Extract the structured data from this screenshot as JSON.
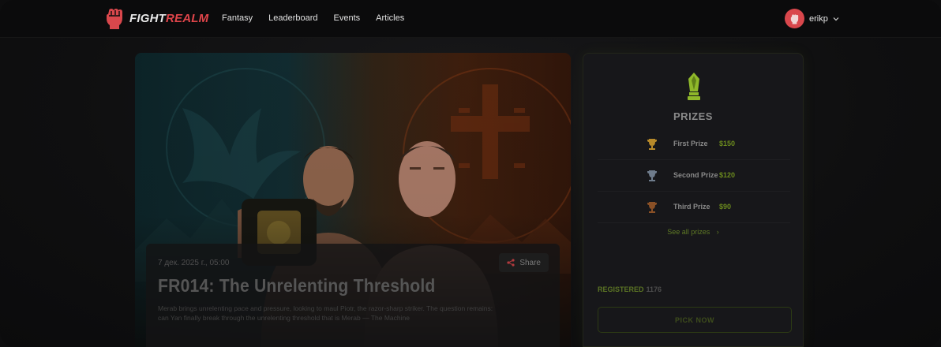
{
  "brand": {
    "logo_part1": "FIGHT",
    "logo_part2": "REALM"
  },
  "nav": {
    "links": [
      "Fantasy",
      "Leaderboard",
      "Events",
      "Articles"
    ]
  },
  "user": {
    "name": "erikp"
  },
  "event": {
    "date": "7 дек. 2025 г., 05:00",
    "share_label": "Share",
    "title": "FR014: The Unrelenting Threshold",
    "description": "Merab brings unrelenting pace and pressure, looking to maul Piotr, the razor-sharp striker. The question remains: can Yan finally break through the unrelenting threshold that is Merab — The Machine"
  },
  "prizes": {
    "title": "PRIZES",
    "items": [
      {
        "name": "First Prize",
        "value": "$150",
        "cup_color": "#b88a2a"
      },
      {
        "name": "Second Prize",
        "value": "$120",
        "cup_color": "#7d8a9a"
      },
      {
        "name": "Third Prize",
        "value": "$90",
        "cup_color": "#9a5a2a"
      }
    ],
    "see_all": "See all prizes",
    "registered_label": "REGISTERED",
    "registered_count": "1176",
    "pick_button": "PICK NOW"
  },
  "colors": {
    "accent": "#8fb82a",
    "brand_red": "#e0454a"
  }
}
